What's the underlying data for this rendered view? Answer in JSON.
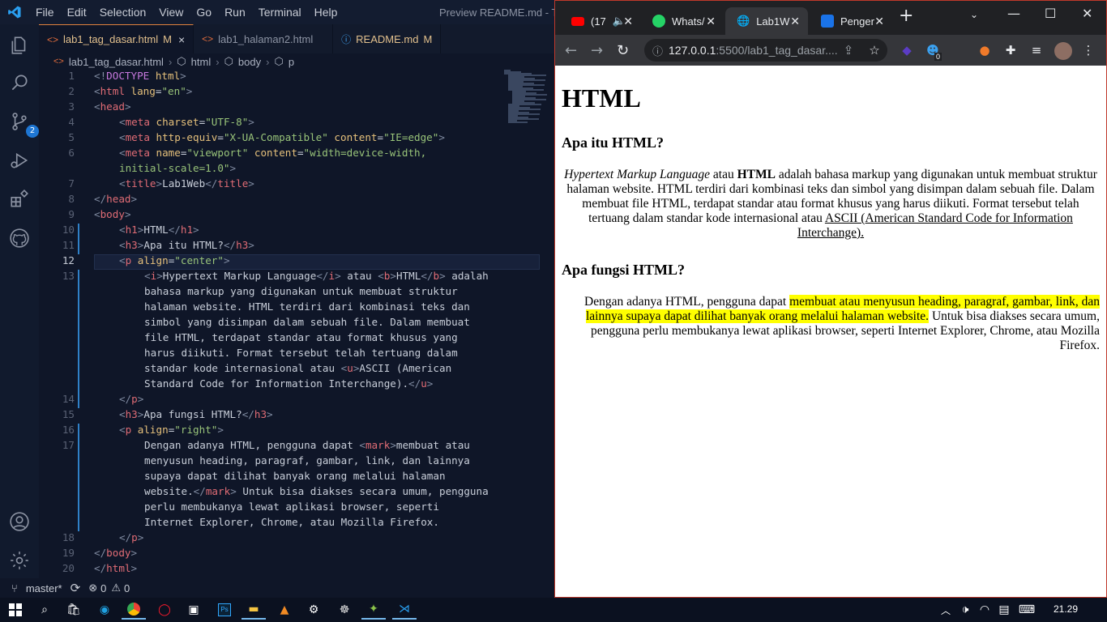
{
  "vscode": {
    "menu": [
      "File",
      "Edit",
      "Selection",
      "View",
      "Go",
      "Run",
      "Terminal",
      "Help"
    ],
    "window_title": "Preview README.md - Tug",
    "tabs": [
      {
        "label": "lab1_tag_dasar.html",
        "modified": "M",
        "close": "×"
      },
      {
        "label": "lab1_halaman2.html"
      },
      {
        "label": "README.md",
        "modified": "M"
      }
    ],
    "breadcrumb": [
      "lab1_tag_dasar.html",
      "html",
      "body",
      "p"
    ],
    "source_control_badge": "2",
    "line_numbers": [
      "1",
      "2",
      "3",
      "4",
      "5",
      "6",
      "",
      "7",
      "8",
      "9",
      "10",
      "11",
      "12",
      "13",
      "",
      "",
      "",
      "",
      "",
      "",
      "",
      "14",
      "15",
      "16",
      "17",
      "",
      "",
      "",
      "",
      "",
      "18",
      "19",
      "20"
    ],
    "code": {
      "l1": [
        "<!",
        "DOCTYPE",
        " html",
        ">"
      ],
      "l2": [
        "<",
        "html",
        " lang",
        "=",
        "\"en\"",
        ">"
      ],
      "l3": [
        "<",
        "head",
        ">"
      ],
      "l4": [
        "<",
        "meta",
        " charset",
        "=",
        "\"UTF-8\"",
        ">"
      ],
      "l5": [
        "<",
        "meta",
        " http-equiv",
        "=",
        "\"X-UA-Compatible\"",
        " content",
        "=",
        "\"IE=edge\"",
        ">"
      ],
      "l6a": [
        "<",
        "meta",
        " name",
        "=",
        "\"viewport\"",
        " content",
        "=",
        "\"width=device-width,"
      ],
      "l6b": "initial-scale=1.0\"",
      "l6c": ">",
      "l7": [
        "<",
        "title",
        ">",
        "Lab1Web",
        "</",
        "title",
        ">"
      ],
      "l8": [
        "</",
        "head",
        ">"
      ],
      "l9": [
        "<",
        "body",
        ">"
      ],
      "l10": [
        "<",
        "h1",
        ">",
        "HTML",
        "</",
        "h1",
        ">"
      ],
      "l11": [
        "<",
        "h3",
        ">",
        "Apa itu HTML?",
        "</",
        "h3",
        ">"
      ],
      "l12": [
        "<",
        "p",
        " align",
        "=",
        "\"center\"",
        ">"
      ],
      "l13a": [
        "<",
        "i",
        ">",
        "Hypertext Markup Language",
        "</",
        "i",
        ">",
        " atau ",
        "<",
        "b",
        ">",
        "HTML",
        "</",
        "b",
        ">",
        " adalah"
      ],
      "l13b": "bahasa markup yang digunakan untuk membuat struktur",
      "l13c": "halaman website. HTML terdiri dari kombinasi teks dan",
      "l13d": "simbol yang disimpan dalam sebuah file. Dalam membuat",
      "l13e": "file HTML, terdapat standar atau format khusus yang",
      "l13f": "harus diikuti. Format tersebut telah tertuang dalam",
      "l13g": [
        "standar kode internasional atau ",
        "<",
        "u",
        ">",
        "ASCII (American"
      ],
      "l13h": [
        "Standard Code for Information Interchange).",
        "</",
        "u",
        ">"
      ],
      "l14": [
        "</",
        "p",
        ">"
      ],
      "l15": [
        "<",
        "h3",
        ">",
        "Apa fungsi HTML?",
        "</",
        "h3",
        ">"
      ],
      "l16": [
        "<",
        "p",
        " align",
        "=",
        "\"right\"",
        ">"
      ],
      "l17a": [
        "Dengan adanya HTML, pengguna dapat ",
        "<",
        "mark",
        ">",
        "membuat atau"
      ],
      "l17b": "menyusun heading, paragraf, gambar, link, dan lainnya",
      "l17c": "supaya dapat dilihat banyak orang melalui halaman",
      "l17d": [
        "website.",
        "</",
        "mark",
        ">",
        " Untuk bisa diakses secara umum, pengguna"
      ],
      "l17e": "perlu membukanya lewat aplikasi browser, seperti",
      "l17f": "Internet Explorer, Chrome, atau Mozilla Firefox.",
      "l18": [
        "</",
        "p",
        ">"
      ],
      "l19": [
        "</",
        "body",
        ">"
      ],
      "l20": [
        "</",
        "html",
        ">"
      ]
    },
    "status": {
      "branch": "master*",
      "errors": "0",
      "warnings": "0"
    }
  },
  "chrome": {
    "tabs": [
      {
        "label": "(17"
      },
      {
        "label": "Whats/"
      },
      {
        "label": "Lab1W"
      },
      {
        "label": "Penger"
      }
    ],
    "url_host": "127.0.0.1",
    "url_path": ":5500/lab1_tag_dasar....",
    "ext_badge": "0",
    "page": {
      "h1": "HTML",
      "h3_1": "Apa itu HTML?",
      "p1_italic": "Hypertext Markup Language",
      "p1_atau": " atau ",
      "p1_bold": "HTML",
      "p1_text": " adalah bahasa markup yang digunakan untuk membuat struktur halaman website. HTML terdiri dari kombinasi teks dan simbol yang disimpan dalam sebuah file. Dalam membuat file HTML, terdapat standar atau format khusus yang harus diikuti. Format tersebut telah tertuang dalam standar kode internasional atau ",
      "p1_underline": "ASCII (American Standard Code for Information Interchange).",
      "h3_2": "Apa fungsi HTML?",
      "p2_text": "Dengan adanya HTML, pengguna dapat ",
      "p2_mark": "membuat atau menyusun heading, paragraf, gambar, link, dan lainnya supaya dapat dilihat banyak orang melalui halaman website.",
      "p2_rest": " Untuk bisa diakses secara umum, pengguna perlu membukanya lewat aplikasi browser, seperti Internet Explorer, Chrome, atau Mozilla Firefox."
    }
  },
  "taskbar": {
    "clock": "21.29"
  },
  "colors": {
    "accent": "#1e76d3",
    "highlight": "#ffff00",
    "tab_modified": "#e2c08d"
  }
}
